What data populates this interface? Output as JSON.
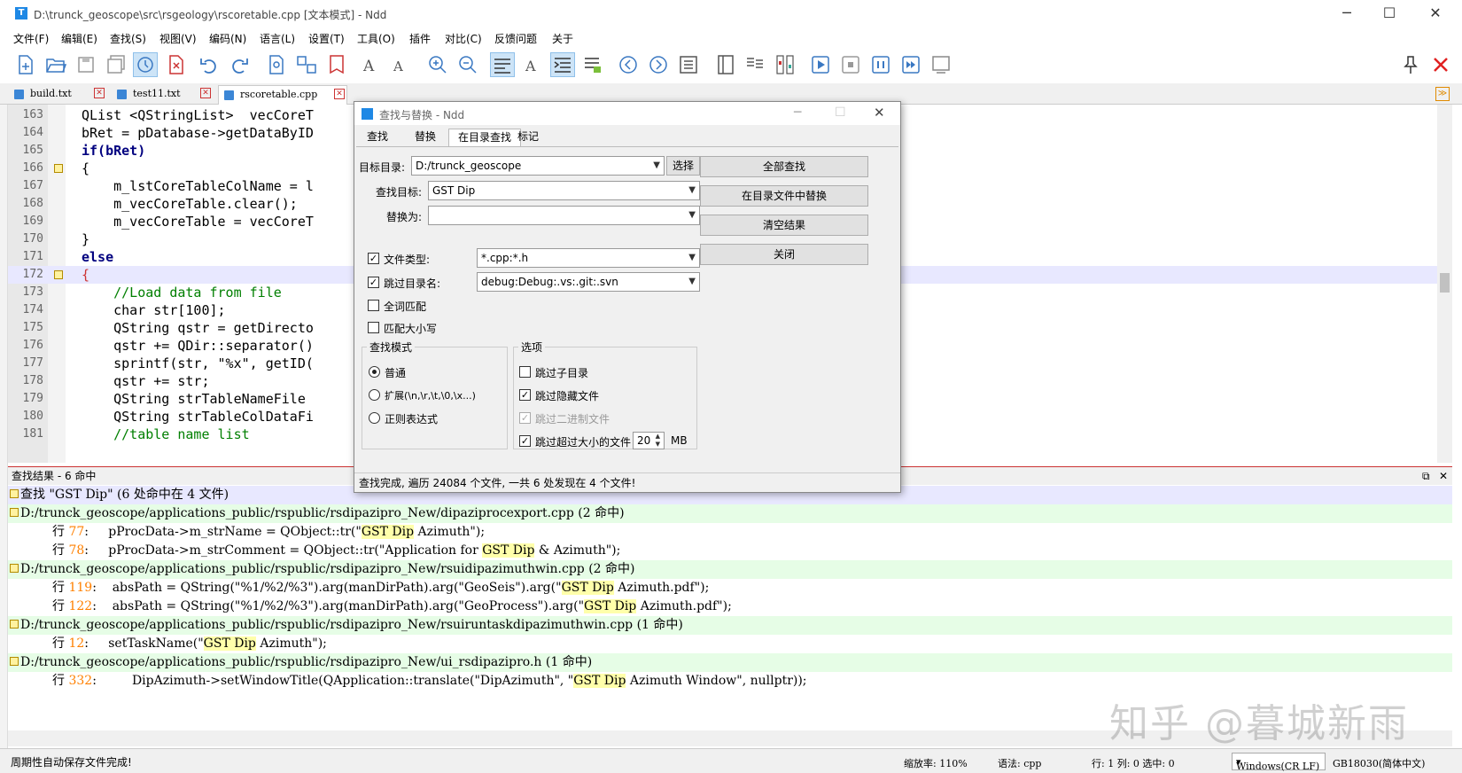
{
  "window": {
    "title": "D:\\trunck_geoscope\\src\\rsgeology\\rscoretable.cpp [文本模式] - Ndd",
    "controls": [
      "─",
      "☐",
      "✕"
    ]
  },
  "menu": [
    "文件(F)",
    "编辑(E)",
    "查找(S)",
    "视图(V)",
    "编码(N)",
    "语言(L)",
    "设置(T)",
    "工具(O)",
    "插件",
    "对比(C)",
    "反馈问题",
    "关于"
  ],
  "tabs": [
    {
      "label": "build.txt"
    },
    {
      "label": "test11.txt"
    },
    {
      "label": "rscoretable.cpp"
    }
  ],
  "editor": {
    "lines": [
      {
        "no": "163",
        "code": "QList <QStringList>  vecCoreT"
      },
      {
        "no": "164",
        "code": "bRet = pDatabase->getDataByID"
      },
      {
        "no": "165",
        "code": "if(bRet)"
      },
      {
        "no": "166",
        "code": "{"
      },
      {
        "no": "167",
        "code": "    m_lstCoreTableColName = l"
      },
      {
        "no": "168",
        "code": "    m_vecCoreTable.clear();"
      },
      {
        "no": "169",
        "code": "    m_vecCoreTable = vecCoreT"
      },
      {
        "no": "170",
        "code": "}"
      },
      {
        "no": "171",
        "code": "else"
      },
      {
        "no": "172",
        "code": "{"
      },
      {
        "no": "173",
        "code": "    //Load data from file"
      },
      {
        "no": "174",
        "code": "    char str[100];"
      },
      {
        "no": "175",
        "code": "    QString qstr = getDirecto"
      },
      {
        "no": "176",
        "code": "    qstr += QDir::separator()"
      },
      {
        "no": "177",
        "code": "    sprintf(str, \"%x\", getID("
      },
      {
        "no": "178",
        "code": "    qstr += str;"
      },
      {
        "no": "179",
        "code": "    QString strTableNameFile "
      },
      {
        "no": "180",
        "code": "    QString strTableColDataFi"
      },
      {
        "no": "181",
        "code": "    //table name list"
      }
    ]
  },
  "dialog": {
    "title": "查找与替换 - Ndd",
    "tabs": [
      "查找",
      "替换",
      "在目录查找",
      "标记"
    ],
    "target_dir_label": "目标目录:",
    "target_dir_value": "D:/trunck_geoscope",
    "choose_button": "选择",
    "find_label": "查找目标:",
    "find_value": "GST Dip",
    "replace_label": "替换为:",
    "replace_value": "",
    "filetype_label": "文件类型:",
    "filetype_value": "*.cpp:*.h",
    "skipdir_label": "跳过目录名:",
    "skipdir_value": "debug:Debug:.vs:.git:.svn",
    "whole_word": "全词匹配",
    "match_case": "匹配大小写",
    "mode_group": "查找模式",
    "mode_normal": "普通",
    "mode_extended": "扩展(\\n,\\r,\\t,\\0,\\x...)",
    "mode_regex": "正则表达式",
    "options_group": "选项",
    "opt_skip_subdir": "跳过子目录",
    "opt_skip_hidden": "跳过隐藏文件",
    "opt_skip_binary": "跳过二进制文件",
    "opt_skip_large": "跳过超过大小的文件",
    "size_value": "20",
    "size_unit": "MB",
    "btn_find_all": "全部查找",
    "btn_replace_in_dir": "在目录文件中替换",
    "btn_clear": "清空结果",
    "btn_close": "关闭",
    "status": "查找完成, 遍历 24084 个文件, 一共 6 处发现在 4 个文件!"
  },
  "results": {
    "header": "查找结果 - 6 命中",
    "summary": "查找 \"GST Dip\" (6 处命中在 4 文件)",
    "files": [
      {
        "path": "D:/trunck_geoscope/applications_public/rspublic/rsdipazipro_New/dipaziprocexport.cpp",
        "count": "(2 命中)",
        "hits": [
          {
            "prefix": "行 ",
            "line": "77",
            "pre": ":     pProcData->m_strName = QObject::tr(\"",
            "hit": "GST Dip",
            "post": " Azimuth\");"
          },
          {
            "prefix": "行 ",
            "line": "78",
            "pre": ":     pProcData->m_strComment = QObject::tr(\"Application for ",
            "hit": "GST Dip",
            "post": " & Azimuth\");"
          }
        ]
      },
      {
        "path": "D:/trunck_geoscope/applications_public/rspublic/rsdipazipro_New/rsuidipazimuthwin.cpp",
        "count": "(2 命中)",
        "hits": [
          {
            "prefix": "行 ",
            "line": "119",
            "pre": ":    absPath = QString(\"%1/%2/%3\").arg(manDirPath).arg(\"GeoSeis\").arg(\"",
            "hit": "GST Dip",
            "post": " Azimuth.pdf\");"
          },
          {
            "prefix": "行 ",
            "line": "122",
            "pre": ":    absPath = QString(\"%1/%2/%3\").arg(manDirPath).arg(\"GeoProcess\").arg(\"",
            "hit": "GST Dip",
            "post": " Azimuth.pdf\");"
          }
        ]
      },
      {
        "path": "D:/trunck_geoscope/applications_public/rspublic/rsdipazipro_New/rsuiruntaskdipazimuthwin.cpp",
        "count": "(1 命中)",
        "hits": [
          {
            "prefix": "行 ",
            "line": "12",
            "pre": ":     setTaskName(\"",
            "hit": "GST Dip",
            "post": " Azimuth\");"
          }
        ]
      },
      {
        "path": "D:/trunck_geoscope/applications_public/rspublic/rsdipazipro_New/ui_rsdipazipro.h",
        "count": "(1 命中)",
        "hits": [
          {
            "prefix": "行 ",
            "line": "332",
            "pre": ":         DipAzimuth->setWindowTitle(QApplication::translate(\"DipAzimuth\", \"",
            "hit": "GST Dip",
            "post": " Azimuth Window\", nullptr));"
          }
        ]
      }
    ],
    "panel_icons": [
      "⧉",
      "✕"
    ]
  },
  "status": {
    "message": "周期性自动保存文件完成!",
    "zoom": "缩放率: 110%",
    "lang": "语法: cpp",
    "pos": "行: 1 列: 0 选中: 0",
    "eol": "Windows(CR LF)",
    "encoding": "GB18030(简体中文)"
  },
  "watermark": "知乎 @暮城新雨"
}
